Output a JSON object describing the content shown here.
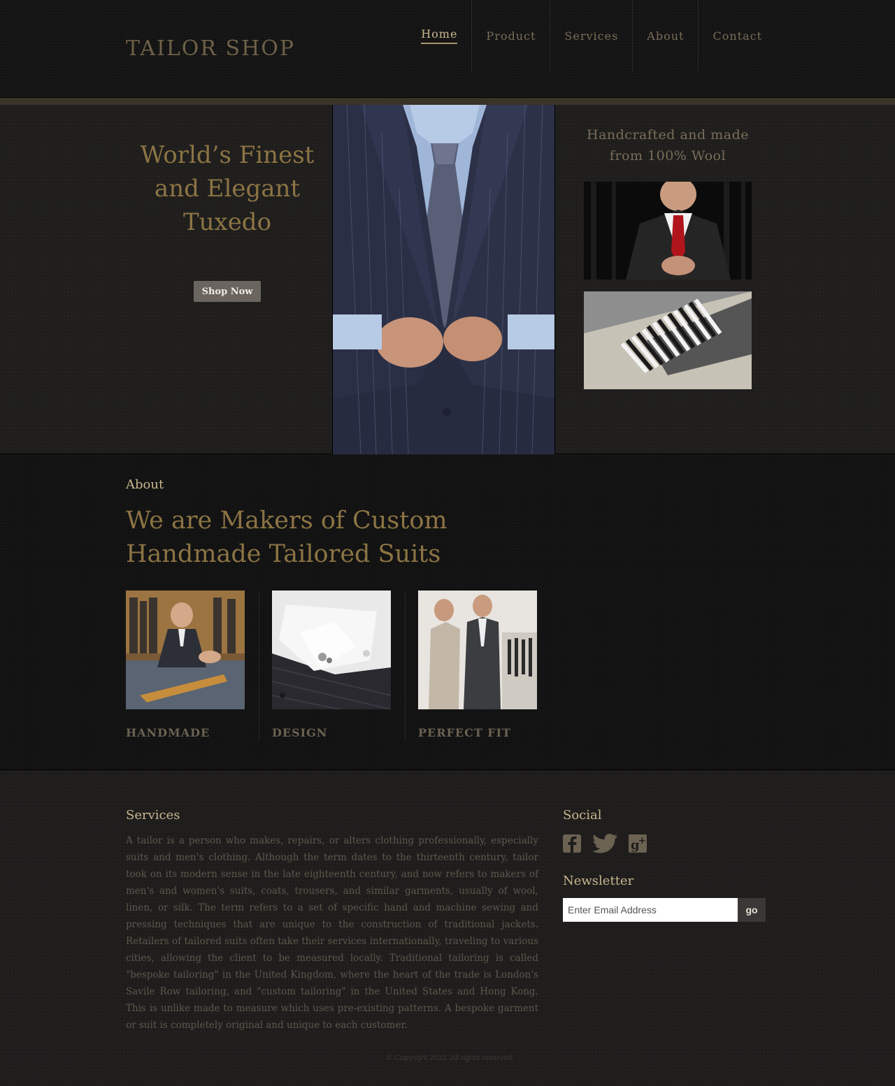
{
  "header": {
    "logo": "TAILOR SHOP",
    "nav": [
      "Home",
      "Product",
      "Services",
      "About",
      "Contact"
    ],
    "active_nav": "Home"
  },
  "hero": {
    "title_lines": [
      "World’s Finest",
      "and Elegant",
      "Tuxedo"
    ],
    "cta": "Shop Now",
    "side_title_lines": [
      "Handcrafted and made",
      "from 100% Wool"
    ]
  },
  "about": {
    "label": "About",
    "heading_lines": [
      "We are Makers of Custom",
      "Handmade Tailored Suits"
    ],
    "features": [
      "HANDMADE",
      "DESIGN",
      "PERFECT FIT"
    ]
  },
  "footer": {
    "services_heading": "Services",
    "services_text": "A tailor is a person who makes, repairs, or alters clothing professionally, especially suits and men's clothing. Although the term dates to the thirteenth century, tailor took on its modern sense in the late eighteenth century, and now refers to makers of men's and women's suits, coats, trousers, and similar garments, usually of wool, linen, or silk. The term refers to a set of specific hand and machine sewing and pressing techniques that are unique to the construction of traditional jackets. Retailers of tailored suits often take their services internationally, traveling to various cities, allowing the client to be measured locally. Traditional tailoring is called \"bespoke tailoring\" in the United Kingdom, where the heart of the trade is London's Savile Row tailoring, and \"custom tailoring\" in the United States and Hong Kong. This is unlike made to measure which uses pre-existing patterns. A bespoke garment or suit is completely original and unique to each customer.",
    "social_heading": "Social",
    "social_icons": [
      "facebook-icon",
      "twitter-icon",
      "google-plus-icon"
    ],
    "newsletter_heading": "Newsletter",
    "email_placeholder": "Enter Email Address",
    "go_label": "go",
    "copyright": "© Copyright 2012. All rights reserved."
  },
  "colors": {
    "accent_gold": "#8c7444",
    "light_gold": "#c8b68f",
    "background": "#1c1b1a"
  }
}
